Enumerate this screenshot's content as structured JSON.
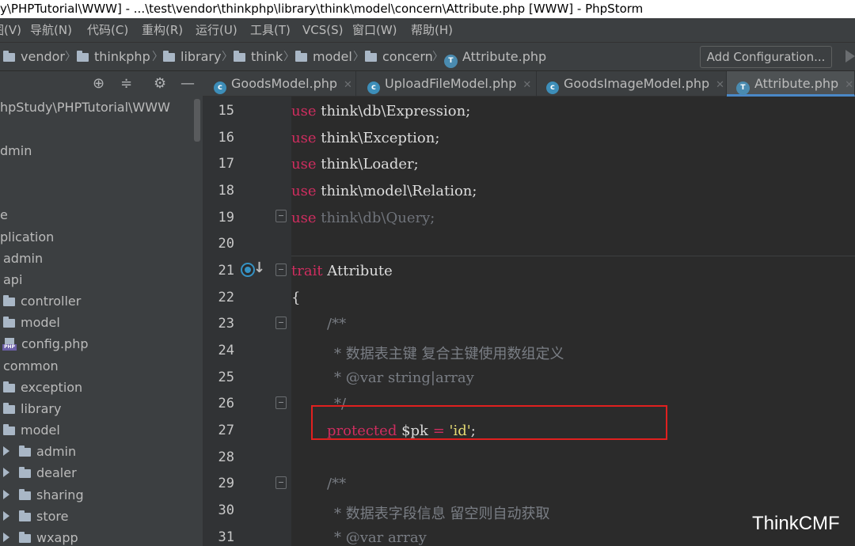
{
  "window": {
    "title": "y\\PHPTutorial\\WWW] - ...\\test\\vendor\\thinkphp\\library\\think\\model\\concern\\Attribute.php [WWW] - PhpStorm"
  },
  "menu": [
    "图(V)",
    "导航(N)",
    "代码(C)",
    "重构(R)",
    "运行(U)",
    "工具(T)",
    "VCS(S)",
    "窗口(W)",
    "帮助(H)"
  ],
  "breadcrumb": [
    "vendor",
    "thinkphp",
    "library",
    "think",
    "model",
    "concern",
    "Attribute.php"
  ],
  "toolbar": {
    "add_configuration": "Add Configuration..."
  },
  "project_tree": [
    "hpStudy\\PHPTutorial\\WWW",
    "dmin",
    "e",
    "plication",
    "admin",
    "api",
    "controller",
    "model",
    "config.php",
    "common",
    "exception",
    "library",
    "model",
    "admin",
    "dealer",
    "sharing",
    "store",
    "wxapp"
  ],
  "tabs": [
    "GoodsModel.php",
    "UploadFileModel.php",
    "GoodsImageModel.php",
    "Attribute.php"
  ],
  "editor": {
    "line_numbers": [
      "15",
      "16",
      "17",
      "18",
      "19",
      "20",
      "21",
      "22",
      "23",
      "24",
      "25",
      "26",
      "27",
      "28",
      "29",
      "30",
      "31"
    ],
    "tokens": {
      "use": "use",
      "l15": "think\\db\\Expression;",
      "l16": "think\\Exception;",
      "l17": "think\\Loader;",
      "l18": "think\\model\\Relation;",
      "l19": "think\\db\\Query;",
      "trait": "trait",
      "trait_name": "Attribute",
      "brace": "{",
      "doc_open": "/**",
      "l24": "* 数据表主键 复合主键使用数组定义",
      "l25": "* @var string|array",
      "doc_close": "*/",
      "protected": "protected",
      "pk_var": "$pk",
      "eq": "=",
      "pk_val": "'id'",
      "semi": ";",
      "l30": "* 数据表字段信息 留空则自动获取",
      "l31": "* @var array"
    }
  },
  "watermark": "ThinkCMF"
}
